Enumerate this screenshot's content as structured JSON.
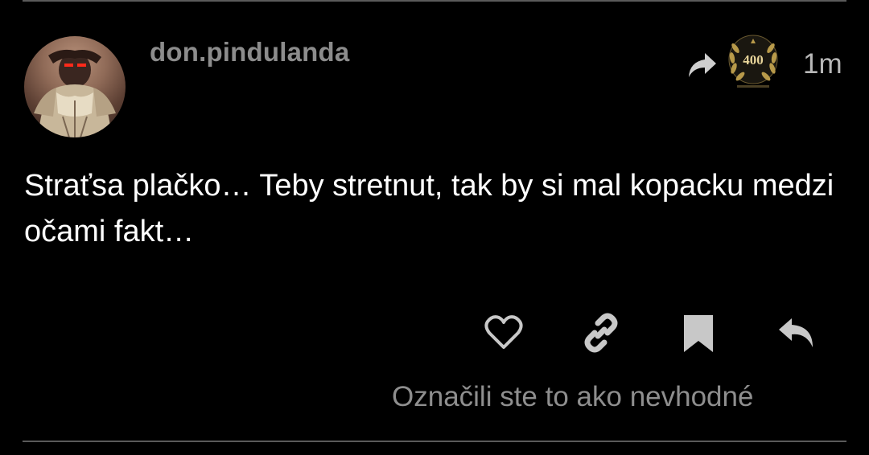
{
  "post": {
    "username": "don.pindulanda",
    "timestamp": "1m",
    "message": "Straťsa plačko… Teby stretnut, tak by si mal kopacku medzi očami fakt…",
    "flag_status": "Označili ste to ako nevhodné",
    "badge": {
      "value": "400",
      "icon": "laurel-wreath-badge-icon"
    }
  },
  "icons": {
    "share": "share-arrow-icon",
    "like": "heart-icon",
    "link": "link-icon",
    "bookmark": "bookmark-icon",
    "reply": "reply-arrow-icon"
  },
  "colors": {
    "background": "#000000",
    "text": "#ffffff",
    "muted": "#8c8c8c",
    "icon": "#c8c8c8",
    "badge_gold": "#b89a4a"
  }
}
